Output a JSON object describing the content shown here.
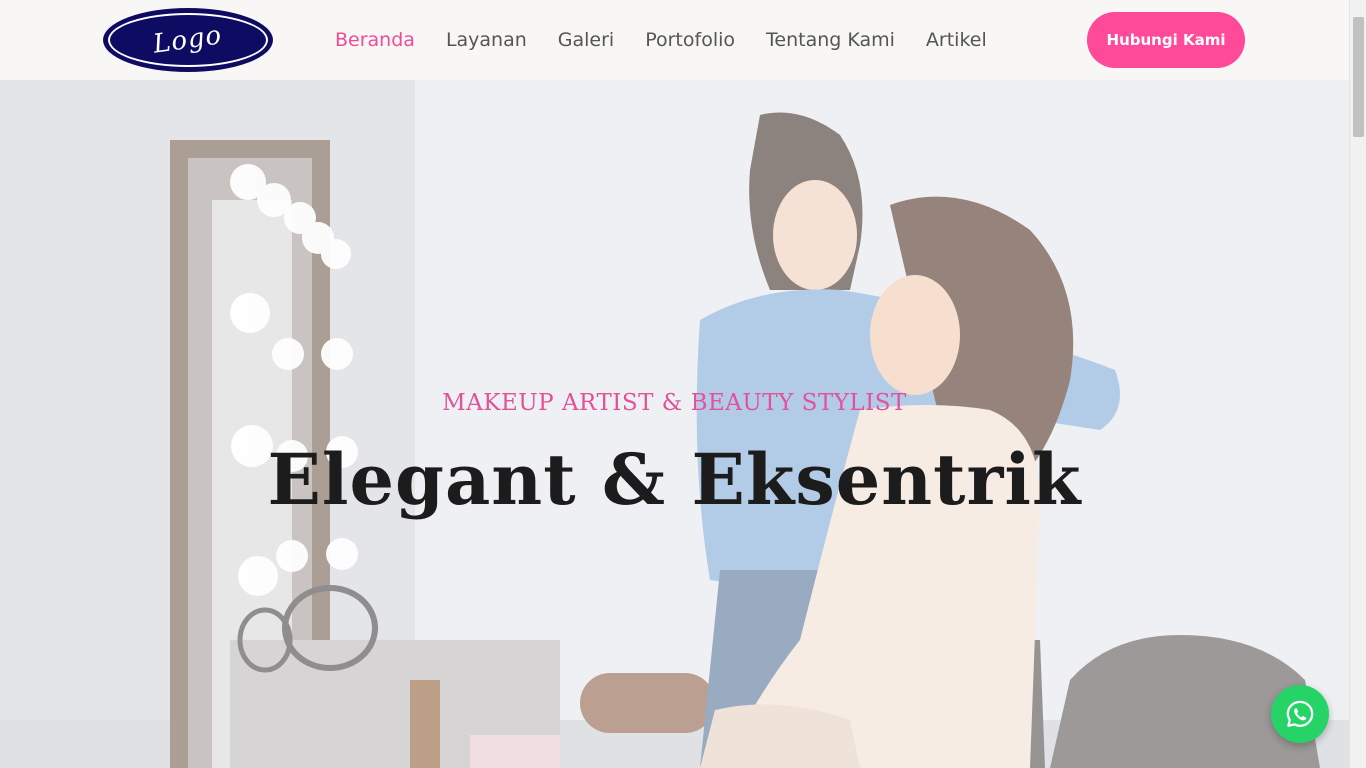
{
  "header": {
    "logo_text": "Logo",
    "nav": [
      {
        "label": "Beranda",
        "active": true
      },
      {
        "label": "Layanan",
        "active": false
      },
      {
        "label": "Galeri",
        "active": false
      },
      {
        "label": "Portofolio",
        "active": false
      },
      {
        "label": "Tentang Kami",
        "active": false
      },
      {
        "label": "Artikel",
        "active": false
      }
    ],
    "cta_label": "Hubungi Kami"
  },
  "hero": {
    "subtitle": "MAKEUP ARTIST & BEAUTY STYLIST",
    "title": "Elegant & Eksentrik"
  },
  "floating": {
    "icon": "whatsapp-icon"
  },
  "colors": {
    "accent": "#fe4a98",
    "nav_active": "#ee4c95",
    "logo_bg": "#0e0b63",
    "whatsapp": "#25d366"
  }
}
